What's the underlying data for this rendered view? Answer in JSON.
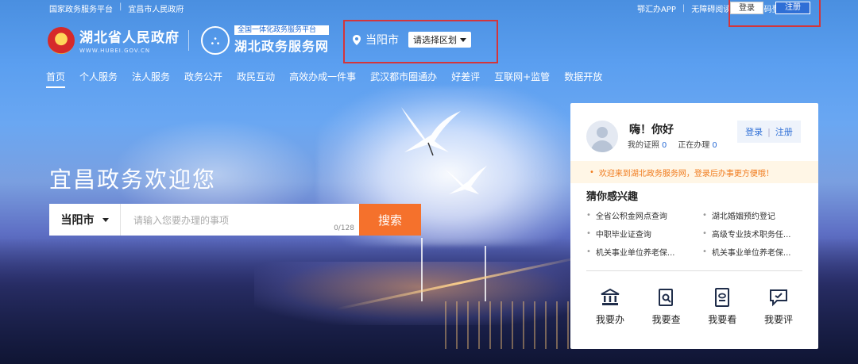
{
  "topbar": {
    "left_links": [
      "国家政务服务平台",
      "宜昌市人民政府"
    ],
    "right_links": [
      "鄂汇办APP",
      "无障碍阅读",
      "扫码登录"
    ],
    "login": "登录",
    "register": "注册"
  },
  "header": {
    "gov_name": "湖北省人民政府",
    "gov_url": "WWW.HUBEI.GOV.CN",
    "service_tag": "全国一体化政务服务平台",
    "service_name": "湖北政务服务网",
    "location_city": "当阳市",
    "region_select": "请选择区划"
  },
  "nav": {
    "items": [
      "首页",
      "个人服务",
      "法人服务",
      "政务公开",
      "政民互动",
      "高效办成一件事",
      "武汉都市圈通办",
      "好差评",
      "互联网+监管",
      "数据开放"
    ],
    "active_index": 0
  },
  "hero": {
    "title": "宜昌政务欢迎您",
    "search_region": "当阳市",
    "search_placeholder": "请输入您要办理的事项",
    "char_count": "0/128",
    "search_button": "搜索"
  },
  "panel": {
    "greeting": "嗨！你好",
    "certs_label": "我的证照",
    "certs_count": "0",
    "inprogress_label": "正在办理",
    "inprogress_count": "0",
    "login": "登录",
    "register": "注册",
    "notice": "欢迎来到湖北政务服务网，登录后办事更方便哦！",
    "guess_title": "猜你感兴趣",
    "guess_items": [
      "全省公积金网点查询",
      "湖北婚姻预约登记",
      "中职毕业证查询",
      "高级专业技术职务任...",
      "机关事业单位养老保...",
      "机关事业单位养老保..."
    ],
    "actions": [
      "我要办",
      "我要查",
      "我要看",
      "我要评"
    ]
  },
  "colors": {
    "search_button": "#f5712c",
    "accent_blue": "#2f6fd6",
    "notice_text": "#f07b1d",
    "highlight_box": "#d3353b"
  }
}
